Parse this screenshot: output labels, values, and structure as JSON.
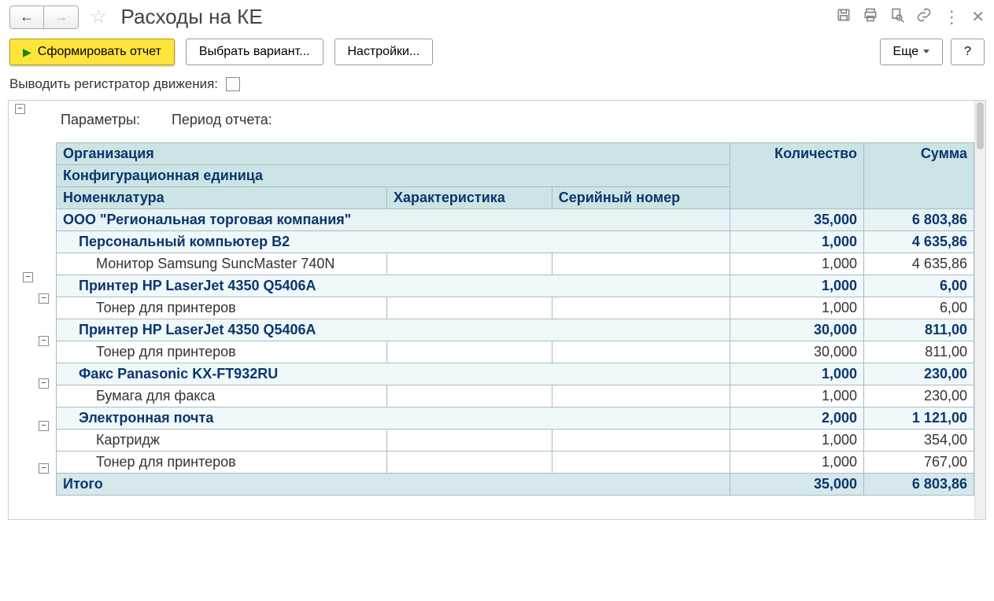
{
  "title": "Расходы на КЕ",
  "toolbar": {
    "run_report": "Сформировать отчет",
    "choose_variant": "Выбрать вариант...",
    "settings": "Настройки...",
    "more": "Еще",
    "help": "?"
  },
  "options": {
    "show_registrar_label": "Выводить регистратор движения:"
  },
  "params": {
    "label": "Параметры:",
    "period_label": "Период отчета:"
  },
  "headers": {
    "organization": "Организация",
    "config_unit": "Конфигурационная единица",
    "nomenclature": "Номенклатура",
    "characteristic": "Характеристика",
    "serial_number": "Серийный номер",
    "quantity": "Количество",
    "sum": "Сумма"
  },
  "rows": {
    "org": {
      "name": "ООО \"Региональная торговая компания\"",
      "qty": "35,000",
      "sum": "6 803,86"
    },
    "g1": {
      "name": "Персональный компьютер B2",
      "qty": "1,000",
      "sum": "4 635,86"
    },
    "g1_1": {
      "name": "Монитор Samsung SuncMaster 740N",
      "qty": "1,000",
      "sum": "4 635,86"
    },
    "g2": {
      "name": "Принтер HP LaserJet 4350 Q5406А",
      "qty": "1,000",
      "sum": "6,00"
    },
    "g2_1": {
      "name": "Тонер для принтеров",
      "qty": "1,000",
      "sum": "6,00"
    },
    "g3": {
      "name": "Принтер HP LaserJet 4350 Q5406А",
      "qty": "30,000",
      "sum": "811,00"
    },
    "g3_1": {
      "name": "Тонер для принтеров",
      "qty": "30,000",
      "sum": "811,00"
    },
    "g4": {
      "name": "Факс Panasonic KX-FT932RU",
      "qty": "1,000",
      "sum": "230,00"
    },
    "g4_1": {
      "name": "Бумага для факса",
      "qty": "1,000",
      "sum": "230,00"
    },
    "g5": {
      "name": "Электронная почта",
      "qty": "2,000",
      "sum": "1 121,00"
    },
    "g5_1": {
      "name": "Картридж",
      "qty": "1,000",
      "sum": "354,00"
    },
    "g5_2": {
      "name": "Тонер для принтеров",
      "qty": "1,000",
      "sum": "767,00"
    },
    "total": {
      "name": "Итого",
      "qty": "35,000",
      "sum": "6 803,86"
    }
  }
}
